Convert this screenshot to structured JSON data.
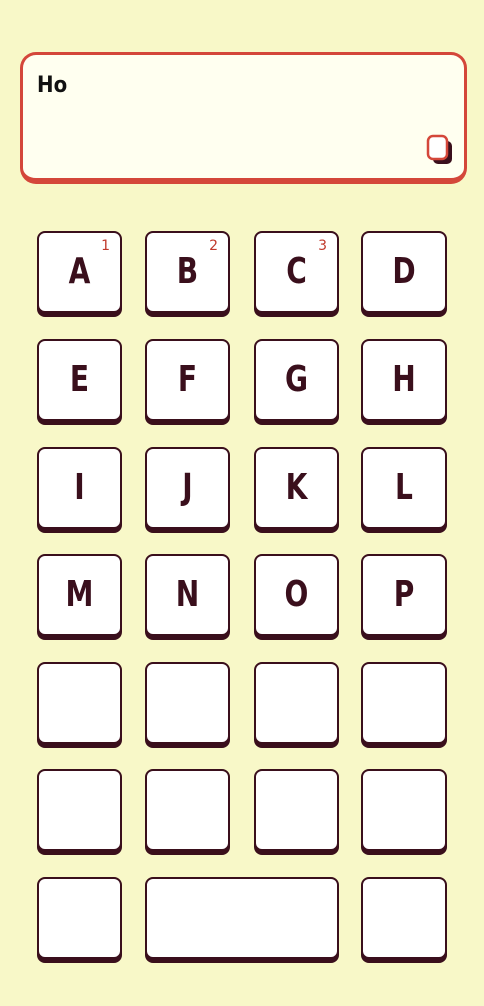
{
  "input": {
    "text": "Ho",
    "copy_icon": "copy-icon"
  },
  "keys": [
    {
      "letter": "A",
      "num": "1"
    },
    {
      "letter": "B",
      "num": "2"
    },
    {
      "letter": "C",
      "num": "3"
    },
    {
      "letter": "D",
      "num": ""
    },
    {
      "letter": "E",
      "num": ""
    },
    {
      "letter": "F",
      "num": ""
    },
    {
      "letter": "G",
      "num": ""
    },
    {
      "letter": "H",
      "num": ""
    },
    {
      "letter": "I",
      "num": ""
    },
    {
      "letter": "J",
      "num": ""
    },
    {
      "letter": "K",
      "num": ""
    },
    {
      "letter": "L",
      "num": ""
    },
    {
      "letter": "M",
      "num": ""
    },
    {
      "letter": "N",
      "num": ""
    },
    {
      "letter": "O",
      "num": ""
    },
    {
      "letter": "P",
      "num": ""
    }
  ],
  "colors": {
    "background": "#f8f8c8",
    "accent": "#d4473a",
    "key_border": "#3a0f1c",
    "number_color": "#c0392b"
  }
}
